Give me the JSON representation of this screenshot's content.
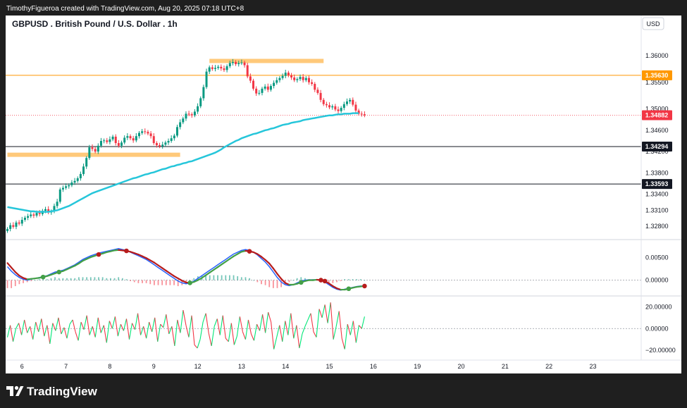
{
  "header": {
    "credit": "TimothyFigueroa created with TradingView.com, Aug 20, 2025 07:18 UTC+8"
  },
  "footer": {
    "brand": "TradingView"
  },
  "colors": {
    "up": "#089981",
    "down": "#f23645",
    "ema": "#26c6da",
    "zone": "#ffb74d",
    "resistance": "#ff9800",
    "support": "#131722",
    "macd": "#2962ff",
    "signal_rising": "#43a047",
    "signal_falling": "#b71c1c",
    "osc_up": "#00e676",
    "osc_down": "#f23645",
    "zero": "#9598a1"
  },
  "chart_data": [
    {
      "type": "candlestick",
      "title": "GBPUSD . British Pound / U.S. Dollar . 1h",
      "currency": "USD",
      "ylim": [
        1.3255,
        1.3625
      ],
      "yticks": [
        1.36,
        1.355,
        1.35,
        1.346,
        1.342,
        1.338,
        1.334,
        1.331,
        1.328
      ],
      "ytick_labels": [
        "1.36000",
        "1.35500",
        "1.35000",
        "1.34600",
        "1.34200",
        "1.33800",
        "1.33400",
        "1.33100",
        "1.32800"
      ],
      "xticks": [
        {
          "label": "6",
          "i": 5
        },
        {
          "label": "7",
          "i": 20
        },
        {
          "label": "8",
          "i": 35
        },
        {
          "label": "9",
          "i": 50
        },
        {
          "label": "12",
          "i": 65
        },
        {
          "label": "13",
          "i": 80
        },
        {
          "label": "14",
          "i": 95
        },
        {
          "label": "15",
          "i": 110
        },
        {
          "label": "16",
          "i": 125
        },
        {
          "label": "19",
          "i": 140
        },
        {
          "label": "20",
          "i": 155
        },
        {
          "label": "21",
          "i": 170
        },
        {
          "label": "22",
          "i": 185
        },
        {
          "label": "23",
          "i": 200
        }
      ],
      "closes": [
        1.3275,
        1.3282,
        1.3279,
        1.3287,
        1.3285,
        1.3292,
        1.3296,
        1.3299,
        1.3302,
        1.33,
        1.3305,
        1.3303,
        1.3309,
        1.3312,
        1.3306,
        1.3308,
        1.3318,
        1.3326,
        1.3349,
        1.3352,
        1.3355,
        1.3357,
        1.3362,
        1.3365,
        1.337,
        1.3378,
        1.3392,
        1.3408,
        1.3428,
        1.3425,
        1.342,
        1.3431,
        1.344,
        1.3441,
        1.3438,
        1.3443,
        1.3448,
        1.3436,
        1.3431,
        1.3437,
        1.3446,
        1.3449,
        1.3445,
        1.3441,
        1.3449,
        1.3455,
        1.3458,
        1.3457,
        1.3454,
        1.3449,
        1.3436,
        1.3432,
        1.343,
        1.3433,
        1.3437,
        1.344,
        1.3445,
        1.345,
        1.3466,
        1.3475,
        1.3482,
        1.3491,
        1.349,
        1.3488,
        1.3495,
        1.3505,
        1.352,
        1.3541,
        1.357,
        1.3578,
        1.3575,
        1.3577,
        1.3579,
        1.3576,
        1.3573,
        1.358,
        1.3586,
        1.3588,
        1.3584,
        1.3586,
        1.3587,
        1.3582,
        1.3561,
        1.3553,
        1.3538,
        1.3529,
        1.353,
        1.3538,
        1.3542,
        1.3536,
        1.3543,
        1.3549,
        1.3554,
        1.3558,
        1.3562,
        1.3568,
        1.3563,
        1.3559,
        1.3554,
        1.3556,
        1.356,
        1.3554,
        1.3558,
        1.355,
        1.3547,
        1.3536,
        1.353,
        1.3517,
        1.3509,
        1.3507,
        1.3503,
        1.3505,
        1.3499,
        1.3496,
        1.3502,
        1.3509,
        1.3514,
        1.3517,
        1.3508,
        1.3497,
        1.3491,
        1.349,
        1.3488
      ],
      "ema_200": [
        1.3316,
        1.3315,
        1.3314,
        1.3313,
        1.3312,
        1.3311,
        1.331,
        1.3309,
        1.3308,
        1.3308,
        1.3307,
        1.3307,
        1.3307,
        1.3307,
        1.3307,
        1.3308,
        1.3309,
        1.331,
        1.3312,
        1.3314,
        1.3316,
        1.3318,
        1.3321,
        1.3324,
        1.3327,
        1.333,
        1.3333,
        1.3336,
        1.3339,
        1.3342,
        1.3344,
        1.3346,
        1.3348,
        1.335,
        1.3352,
        1.3354,
        1.3356,
        1.3358,
        1.336,
        1.3362,
        1.3364,
        1.3366,
        1.3368,
        1.337,
        1.3371,
        1.3373,
        1.3375,
        1.3377,
        1.3378,
        1.338,
        1.3381,
        1.3383,
        1.3385,
        1.3387,
        1.3388,
        1.339,
        1.3392,
        1.3393,
        1.3395,
        1.3396,
        1.3398,
        1.3399,
        1.3401,
        1.3402,
        1.3404,
        1.3406,
        1.3408,
        1.341,
        1.3412,
        1.3414,
        1.3416,
        1.3418,
        1.3421,
        1.3424,
        1.3428,
        1.3431,
        1.3434,
        1.3437,
        1.344,
        1.3442,
        1.3445,
        1.3447,
        1.3449,
        1.3451,
        1.3453,
        1.3454,
        1.3456,
        1.3458,
        1.346,
        1.3461,
        1.3463,
        1.3464,
        1.3466,
        1.3468,
        1.347,
        1.3471,
        1.3472,
        1.3474,
        1.3475,
        1.3476,
        1.3477,
        1.3479,
        1.348,
        1.3481,
        1.3482,
        1.3483,
        1.3484,
        1.3485,
        1.3486,
        1.3487,
        1.3488,
        1.3488,
        1.3489,
        1.349,
        1.349,
        1.3491,
        1.3491,
        1.3491,
        1.3492,
        1.3492,
        1.3492
      ],
      "zones": [
        {
          "price": 1.359,
          "from": 69,
          "to": 108
        },
        {
          "price": 1.3414,
          "from": 0,
          "to": 59
        }
      ],
      "levels": [
        {
          "price": 1.3563,
          "label": "1.35630",
          "kind": "resistance"
        },
        {
          "price": 1.34294,
          "label": "1.34294",
          "kind": "support"
        },
        {
          "price": 1.33593,
          "label": "1.33593",
          "kind": "support"
        }
      ],
      "last_price": {
        "price": 1.34882,
        "label": "1.34882"
      }
    },
    {
      "type": "line",
      "name": "MACD",
      "ylim": [
        -0.0035,
        0.009
      ],
      "yticks": [
        0.005,
        0.0
      ],
      "ytick_labels": [
        "0.00500",
        "0.00000"
      ],
      "macd": [
        0.003,
        0.002,
        0.0012,
        0.0006,
        0.0002,
        0.0,
        0.0002,
        0.0004,
        0.0006,
        0.0008,
        0.001,
        0.0014,
        0.0018,
        0.002,
        0.0022,
        0.0026,
        0.003,
        0.0034,
        0.004,
        0.0046,
        0.005,
        0.0054,
        0.0057,
        0.006,
        0.0062,
        0.0064,
        0.0066,
        0.0068,
        0.007,
        0.0068,
        0.0066,
        0.0062,
        0.0058,
        0.0054,
        0.005,
        0.0046,
        0.004,
        0.0034,
        0.0028,
        0.0022,
        0.0016,
        0.001,
        0.0004,
        -0.0002,
        -0.0006,
        -0.0008,
        -0.0006,
        -0.0002,
        0.0004,
        0.001,
        0.0016,
        0.0022,
        0.0028,
        0.0034,
        0.004,
        0.0046,
        0.0052,
        0.0058,
        0.0062,
        0.0066,
        0.0068,
        0.0066,
        0.0062,
        0.0056,
        0.0048,
        0.004,
        0.003,
        0.0018,
        0.0006,
        -0.0004,
        -0.001,
        -0.0012,
        -0.001,
        -0.0006,
        -0.0002,
        0.0,
        0.0001,
        0.0001,
        0.0001,
        0.0,
        -0.0004,
        -0.001,
        -0.0016,
        -0.002,
        -0.0022,
        -0.002,
        -0.0018,
        -0.0016,
        -0.0014,
        -0.0013,
        -0.0013
      ],
      "signal": [
        0.0038,
        0.0028,
        0.0018,
        0.001,
        0.0005,
        0.0002,
        0.0003,
        0.0004,
        0.0005,
        0.0007,
        0.0009,
        0.0012,
        0.0015,
        0.0018,
        0.002,
        0.0024,
        0.0028,
        0.0032,
        0.0037,
        0.0043,
        0.0047,
        0.0051,
        0.0054,
        0.0057,
        0.0059,
        0.0062,
        0.0064,
        0.0066,
        0.0067,
        0.0066,
        0.0065,
        0.0063,
        0.006,
        0.0057,
        0.0053,
        0.0049,
        0.0044,
        0.0039,
        0.0033,
        0.0027,
        0.0021,
        0.0015,
        0.0009,
        0.0004,
        -0.0001,
        -0.0005,
        -0.0006,
        -0.0004,
        0.0,
        0.0005,
        0.0011,
        0.0017,
        0.0023,
        0.0029,
        0.0035,
        0.0041,
        0.0047,
        0.0053,
        0.0058,
        0.0063,
        0.0065,
        0.0064,
        0.0062,
        0.0058,
        0.0052,
        0.0045,
        0.0037,
        0.0026,
        0.0014,
        0.0003,
        -0.0006,
        -0.001,
        -0.001,
        -0.0008,
        -0.0005,
        -0.0002,
        0.0,
        0.0,
        0.0001,
        0.0,
        -0.0002,
        -0.0007,
        -0.0013,
        -0.0018,
        -0.0021,
        -0.0021,
        -0.0019,
        -0.0017,
        -0.0015,
        -0.0014,
        -0.0013
      ],
      "markers": [
        {
          "i": 9,
          "kind": "bull"
        },
        {
          "i": 13,
          "kind": "bull"
        },
        {
          "i": 23,
          "kind": "bear"
        },
        {
          "i": 30,
          "kind": "bear"
        },
        {
          "i": 46,
          "kind": "bull"
        },
        {
          "i": 61,
          "kind": "bear"
        },
        {
          "i": 74,
          "kind": "bull"
        },
        {
          "i": 79,
          "kind": "bear"
        },
        {
          "i": 80,
          "kind": "bear"
        },
        {
          "i": 86,
          "kind": "bull"
        },
        {
          "i": 90,
          "kind": "bear"
        }
      ]
    },
    {
      "type": "line",
      "name": "Oscillator",
      "ylim": [
        -29,
        30
      ],
      "yticks": [
        20,
        0,
        -20
      ],
      "ytick_labels": [
        "20.00000",
        "0.00000",
        "−20.00000"
      ],
      "values": [
        -8,
        3,
        -12,
        0,
        5,
        -6,
        8,
        -4,
        2,
        -10,
        6,
        -3,
        9,
        -7,
        3,
        -14,
        5,
        -2,
        10,
        -5,
        1,
        -9,
        4,
        8,
        -3,
        -11,
        6,
        -1,
        12,
        -6,
        2,
        -8,
        10,
        -4,
        3,
        -13,
        7,
        0,
        11,
        -7,
        4,
        -2,
        9,
        -10,
        5,
        -1,
        14,
        -6,
        2,
        -9,
        6,
        -3,
        10,
        -12,
        4,
        1,
        13,
        -5,
        2,
        -16,
        8,
        -4,
        17,
        3,
        -8,
        12,
        -15,
        -18,
        -10,
        6,
        14,
        -4,
        -16,
        2,
        9,
        -6,
        12,
        -9,
        -12,
        5,
        -15,
        -7,
        11,
        -3,
        -10,
        8,
        -5,
        -11,
        4,
        -2,
        13,
        -4,
        15,
        6,
        -19,
        -8,
        3,
        -12,
        7,
        -6,
        14,
        -9,
        3,
        -18,
        -5,
        2,
        8,
        14,
        -3,
        -8,
        18,
        10,
        22,
        5,
        24,
        -10,
        2,
        16,
        -9,
        -19,
        4,
        -6,
        7,
        -13,
        3,
        0,
        11
      ]
    }
  ]
}
